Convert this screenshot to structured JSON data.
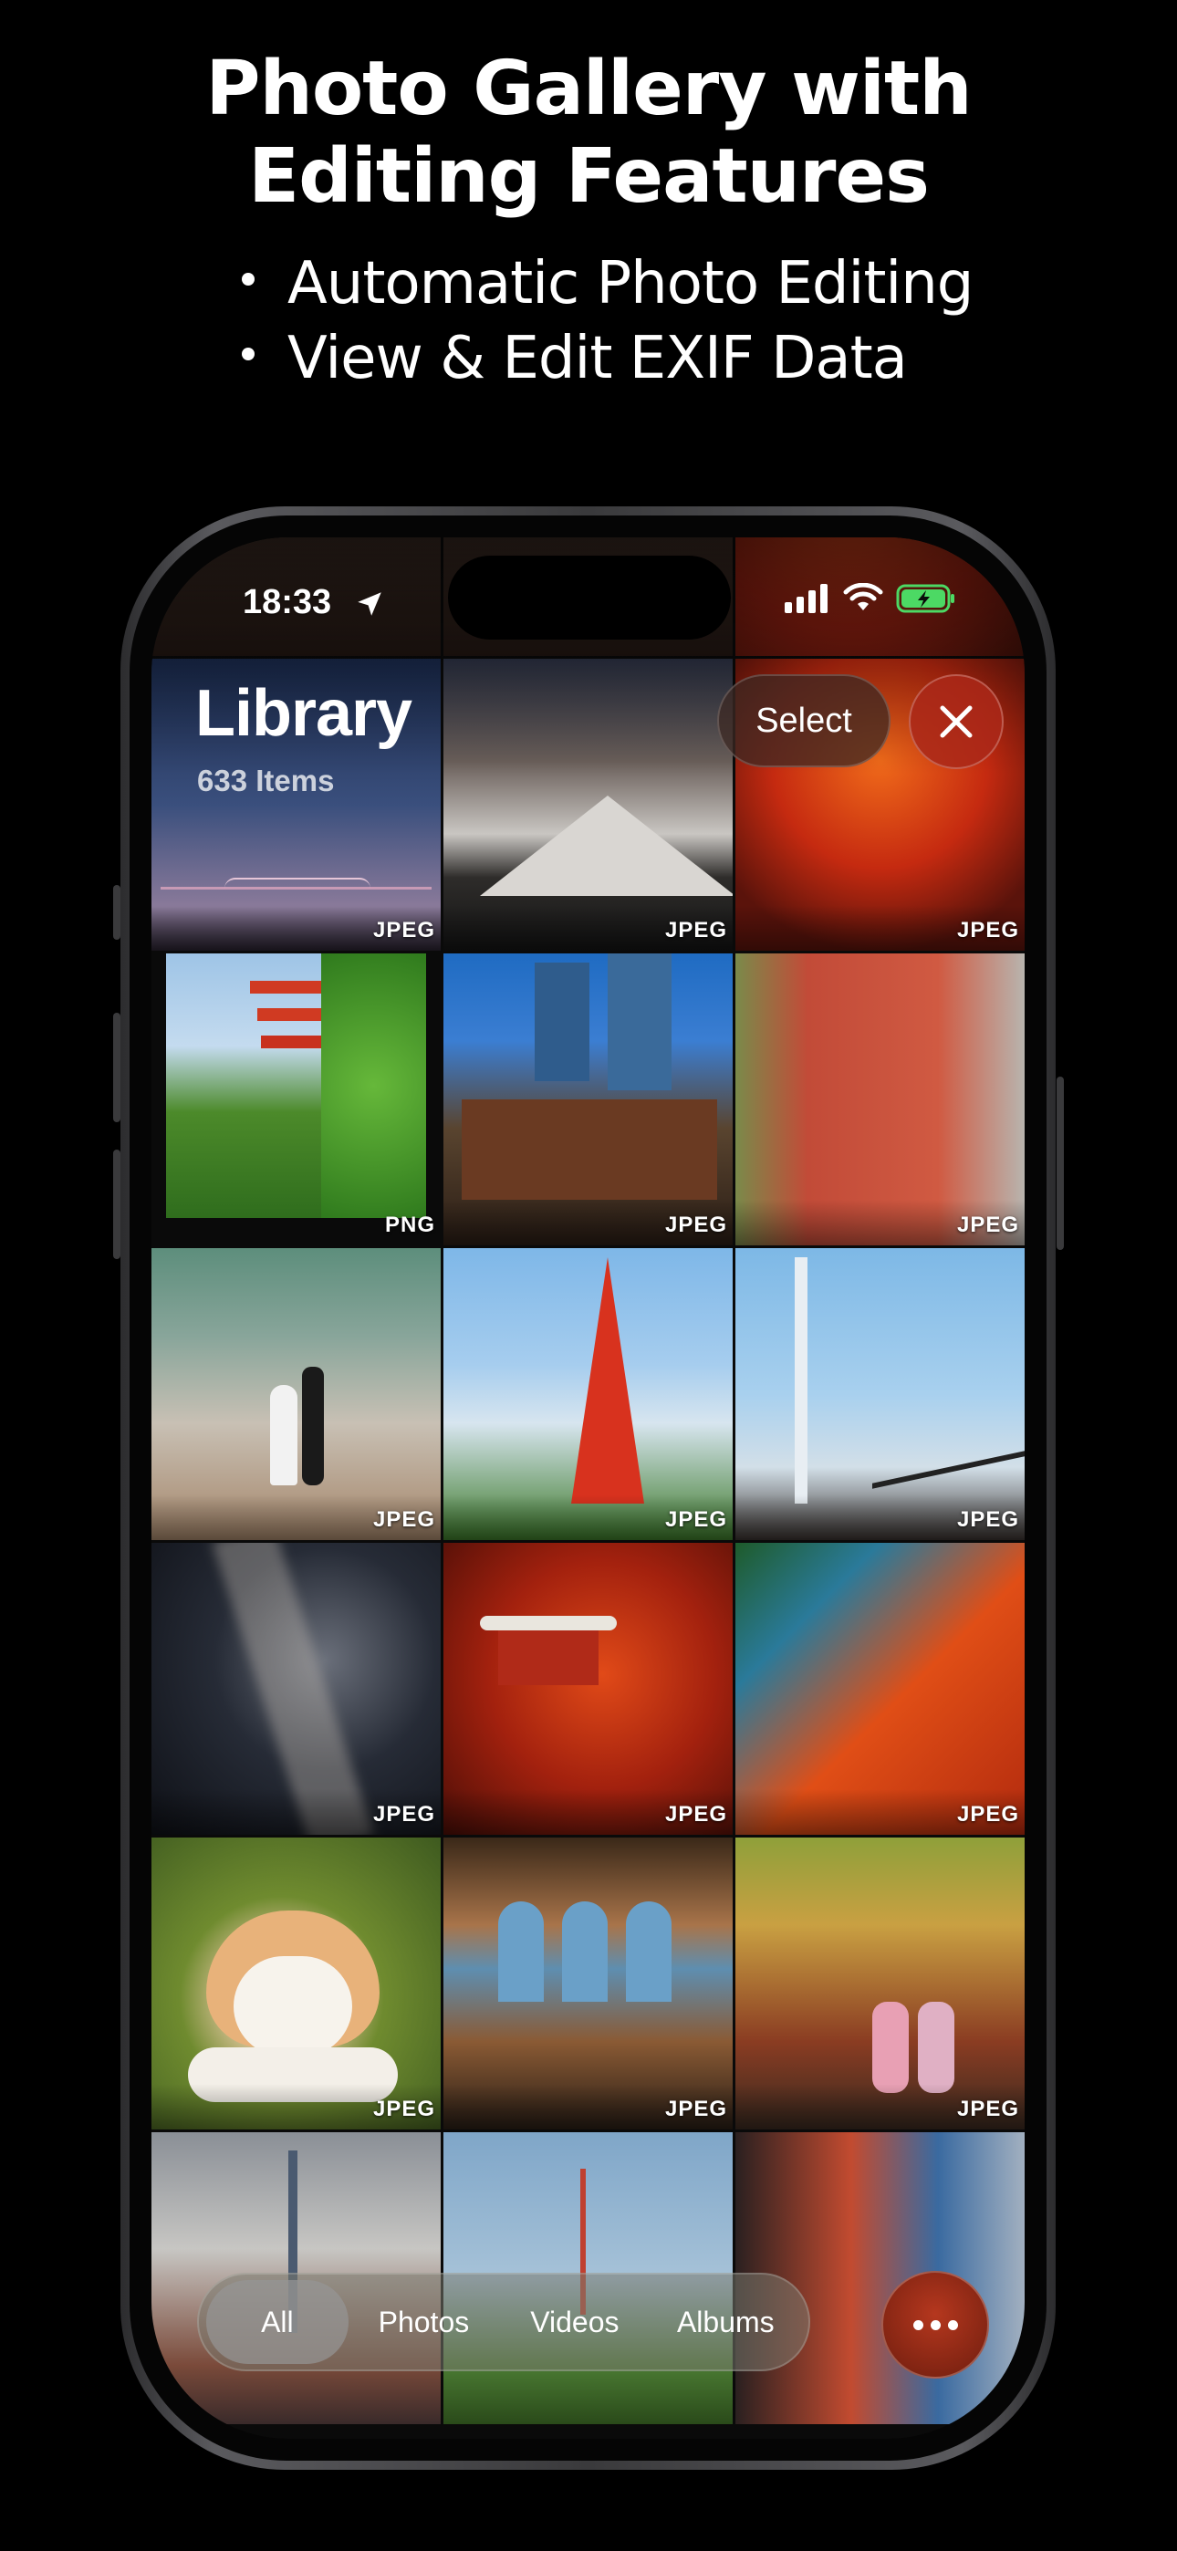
{
  "promo": {
    "title_line1": "Photo Gallery with",
    "title_line2": "Editing Features",
    "bullets": [
      "Automatic Photo Editing",
      "View & Edit EXIF Data"
    ]
  },
  "status_bar": {
    "time": "18:33"
  },
  "header": {
    "title": "Library",
    "count": "633 Items",
    "select_label": "Select"
  },
  "tabs": [
    {
      "label": "All",
      "active": true
    },
    {
      "label": "Photos",
      "active": false
    },
    {
      "label": "Videos",
      "active": false
    },
    {
      "label": "Albums",
      "active": false
    }
  ],
  "photos": [
    {
      "subject": "night-sky",
      "format": ""
    },
    {
      "subject": "dark-scene",
      "format": ""
    },
    {
      "subject": "red-maples",
      "format": ""
    },
    {
      "subject": "bridge-dusk",
      "format": "JPEG"
    },
    {
      "subject": "snowy-mountain",
      "format": "JPEG"
    },
    {
      "subject": "autumn-maple",
      "format": "JPEG"
    },
    {
      "subject": "pagoda",
      "format": "PNG"
    },
    {
      "subject": "tokyo-station",
      "format": "JPEG"
    },
    {
      "subject": "red-wall",
      "format": "JPEG"
    },
    {
      "subject": "wedding-couple",
      "format": "JPEG"
    },
    {
      "subject": "tokyo-tower",
      "format": "JPEG"
    },
    {
      "subject": "skytree-sakura",
      "format": "JPEG"
    },
    {
      "subject": "milky-way",
      "format": "JPEG"
    },
    {
      "subject": "temple-autumn",
      "format": "JPEG"
    },
    {
      "subject": "autumn-leaves",
      "format": "JPEG"
    },
    {
      "subject": "corgi",
      "format": "JPEG"
    },
    {
      "subject": "grand-central",
      "format": "JPEG"
    },
    {
      "subject": "kimono-garden",
      "format": "JPEG"
    },
    {
      "subject": "street-tower",
      "format": ""
    },
    {
      "subject": "street-green",
      "format": ""
    },
    {
      "subject": "colorful-building",
      "format": ""
    }
  ]
}
